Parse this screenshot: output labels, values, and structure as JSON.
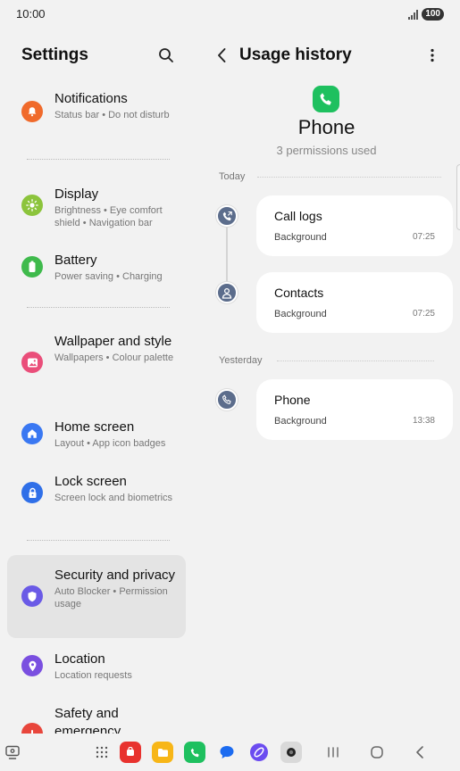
{
  "status_bar": {
    "time": "10:00",
    "battery": "100"
  },
  "left_pane": {
    "title": "Settings",
    "items": [
      {
        "title": "Notifications",
        "subtitle": "Status bar  •  Do not disturb",
        "color": "#f06a2b",
        "icon": "bell-icon"
      },
      {
        "title": "Display",
        "subtitle": "Brightness  •  Eye comfort shield  •  Navigation bar",
        "color": "#8cc43c",
        "icon": "sun-icon"
      },
      {
        "title": "Battery",
        "subtitle": "Power saving  •  Charging",
        "color": "#3fba4c",
        "icon": "battery-icon"
      },
      {
        "title": "Wallpaper and style",
        "subtitle": "Wallpapers  •  Colour palette",
        "color": "#ea4e7a",
        "icon": "image-icon"
      },
      {
        "title": "Home screen",
        "subtitle": "Layout  •  App icon badges",
        "color": "#3a78f2",
        "icon": "home-icon"
      },
      {
        "title": "Lock screen",
        "subtitle": "Screen lock and biometrics",
        "color": "#2f6fe8",
        "icon": "lock-icon"
      },
      {
        "title": "Security and privacy",
        "subtitle": "Auto Blocker  •  Permission usage",
        "color": "#6a5ae6",
        "icon": "shield-icon"
      },
      {
        "title": "Location",
        "subtitle": "Location requests",
        "color": "#7a4fe0",
        "icon": "location-pin-icon"
      },
      {
        "title": "Safety and emergency",
        "subtitle": "",
        "color": "#e8463c",
        "icon": "emergency-icon"
      }
    ]
  },
  "right_pane": {
    "title": "Usage history",
    "app_name": "Phone",
    "permissions_used": "3 permissions used",
    "sections": [
      {
        "label": "Today",
        "entries": [
          {
            "title": "Call logs",
            "status": "Background",
            "time": "07:25",
            "icon": "call-log-icon"
          },
          {
            "title": "Contacts",
            "status": "Background",
            "time": "07:25",
            "icon": "contacts-icon"
          }
        ]
      },
      {
        "label": "Yesterday",
        "entries": [
          {
            "title": "Phone",
            "status": "Background",
            "time": "13:38",
            "icon": "phone-icon"
          }
        ]
      }
    ]
  },
  "taskbar": {
    "apps": [
      {
        "name": "galaxy-store",
        "color": "#e8322e"
      },
      {
        "name": "my-files",
        "color": "#f7b617"
      },
      {
        "name": "phone",
        "color": "#1ec05f"
      },
      {
        "name": "messages",
        "color": "#1c6bf0"
      },
      {
        "name": "internet",
        "color": "#6b4cf0"
      },
      {
        "name": "camera",
        "color": "#d9d9d9"
      }
    ]
  }
}
